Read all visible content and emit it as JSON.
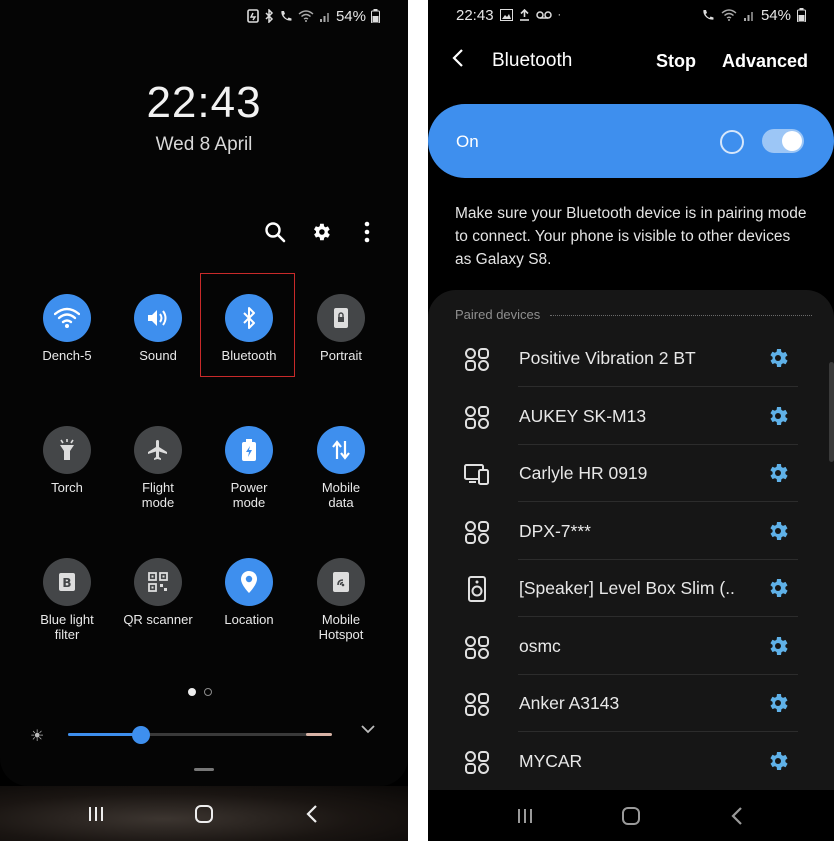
{
  "left_screen": {
    "status": {
      "battery": "54%",
      "icons": [
        "battery-saver-icon",
        "bluetooth-icon",
        "wifi-calling-icon",
        "wifi-icon",
        "signal-icon"
      ]
    },
    "clock": {
      "time": "22:43",
      "date": "Wed 8 April"
    },
    "toolbar": {
      "icons": [
        "search-icon",
        "settings-gear-icon",
        "more-options-icon"
      ]
    },
    "tiles": [
      {
        "label": "Dench-5",
        "icon": "wifi-icon",
        "active": true
      },
      {
        "label": "Sound",
        "icon": "volume-icon",
        "active": true
      },
      {
        "label": "Bluetooth",
        "icon": "bluetooth-icon",
        "active": true,
        "highlighted": true
      },
      {
        "label": "Portrait",
        "icon": "rotation-lock-icon",
        "active": false
      },
      {
        "label": "Torch",
        "icon": "torch-icon",
        "active": false
      },
      {
        "label": "Flight mode",
        "label_lines": [
          "Flight",
          "mode"
        ],
        "icon": "airplane-icon",
        "active": false
      },
      {
        "label": "Power mode",
        "label_lines": [
          "Power",
          "mode"
        ],
        "icon": "battery-icon",
        "active": true
      },
      {
        "label": "Mobile data",
        "label_lines": [
          "Mobile",
          "data"
        ],
        "icon": "data-arrows-icon",
        "active": true
      },
      {
        "label": "Blue light filter",
        "label_lines": [
          "Blue light",
          "filter"
        ],
        "icon": "blue-light-icon",
        "active": false
      },
      {
        "label": "QR scanner",
        "icon": "qr-code-icon",
        "active": false
      },
      {
        "label": "Location",
        "icon": "location-pin-icon",
        "active": true
      },
      {
        "label": "Mobile Hotspot",
        "label_lines": [
          "Mobile",
          "Hotspot"
        ],
        "icon": "hotspot-icon",
        "active": false
      }
    ],
    "pager": {
      "pages": 2,
      "current": 1
    },
    "brightness": {
      "level": 0.28
    },
    "navbar": [
      "recent-apps-icon",
      "home-icon",
      "back-icon"
    ]
  },
  "right_screen": {
    "status": {
      "time": "22:43",
      "battery": "54%",
      "left_icons": [
        "gallery-icon",
        "upload-icon",
        "voicemail-icon"
      ],
      "right_icons": [
        "wifi-calling-icon",
        "wifi-icon",
        "signal-icon"
      ]
    },
    "header": {
      "title": "Bluetooth",
      "stop_label": "Stop",
      "advanced_label": "Advanced"
    },
    "master_switch": {
      "label": "On",
      "checked": true
    },
    "description": "Make sure your Bluetooth device is in pairing mode to connect. Your phone is visible to other devices as Galaxy S8.",
    "paired": {
      "heading": "Paired devices",
      "devices": [
        {
          "name": "Positive Vibration 2 BT",
          "icon": "headphones-device-icon"
        },
        {
          "name": "AUKEY SK-M13",
          "icon": "headphones-device-icon"
        },
        {
          "name": "Carlyle HR 0919",
          "icon": "watch-device-icon"
        },
        {
          "name": "DPX-7***",
          "icon": "headphones-device-icon"
        },
        {
          "name": "[Speaker] Level Box Slim (..",
          "icon": "speaker-device-icon"
        },
        {
          "name": "osmc",
          "icon": "headphones-device-icon"
        },
        {
          "name": "Anker A3143",
          "icon": "headphones-device-icon"
        },
        {
          "name": "MYCAR",
          "icon": "headphones-device-icon"
        }
      ]
    },
    "navbar": [
      "recent-apps-icon",
      "home-icon",
      "back-icon"
    ],
    "colors": {
      "accent": "#3e8fee",
      "gear": "#5fb1e8",
      "tile_off": "#444648"
    }
  }
}
